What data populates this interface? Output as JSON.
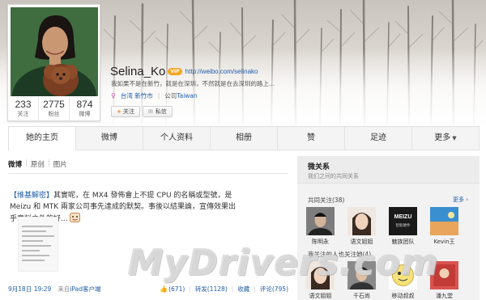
{
  "profile": {
    "name": "Selina_Ko",
    "vip_badge": "VIP",
    "homepage": "http://weibo.com/selinako",
    "bio": "我如果不是在新竹，就是在深圳，不然就是在去深圳的路上...",
    "location": "台湾 新竹市",
    "company_prefix": "公司",
    "company": "Taiwan",
    "stats": [
      {
        "value": "233",
        "label": "关注"
      },
      {
        "value": "2775",
        "label": "粉丝"
      },
      {
        "value": "874",
        "label": "微博"
      }
    ],
    "follow_button": "关注",
    "message_button": "私信"
  },
  "nav": {
    "tabs": [
      {
        "label": "她的主页"
      },
      {
        "label": "微博"
      },
      {
        "label": "个人资料"
      },
      {
        "label": "相册"
      },
      {
        "label": "赞"
      },
      {
        "label": "足迹"
      },
      {
        "label": "更多"
      }
    ]
  },
  "feed": {
    "filters": [
      "微博",
      "原创",
      "图片"
    ],
    "post": {
      "tag": "【维基解密】",
      "text": "其實呢，在 MX4 發佈會上不提 CPU 的名稱或型號，是 Meizu 和 MTK 兩家公司事先達成的默契。事後以結果論，宣傳效果出乎意料之外的好...",
      "time": "9月18日 19:29",
      "source_prefix": "来自",
      "source": "iPad客户端",
      "like_count": "(671)",
      "repost": "转发(1128)",
      "favorite": "收藏",
      "comment": "评论(795)"
    }
  },
  "sidebar": {
    "title": "微关系",
    "subtitle": "我们之间的共同关系",
    "common_follows_title": "共同关注(38)",
    "more": "更多",
    "common_follows": [
      {
        "name": "陈明永"
      },
      {
        "name": "语文姐姐"
      },
      {
        "name": "魅族团队"
      },
      {
        "name": "Kevin王"
      }
    ],
    "mutual_title": "我关注的人也关注她(4)",
    "mutual": [
      {
        "name": "语文姐姐"
      },
      {
        "name": "千石尚"
      },
      {
        "name": "移动叔叔"
      },
      {
        "name": "潘九堂"
      }
    ],
    "meizu_logo": "MEIZU",
    "meizu_sub": "智能硬件"
  },
  "watermark": "MyDrivers.com",
  "colors": {
    "link": "#1f5ea8",
    "accent_orange": "#f07b1e",
    "vip": "#f5a623"
  }
}
